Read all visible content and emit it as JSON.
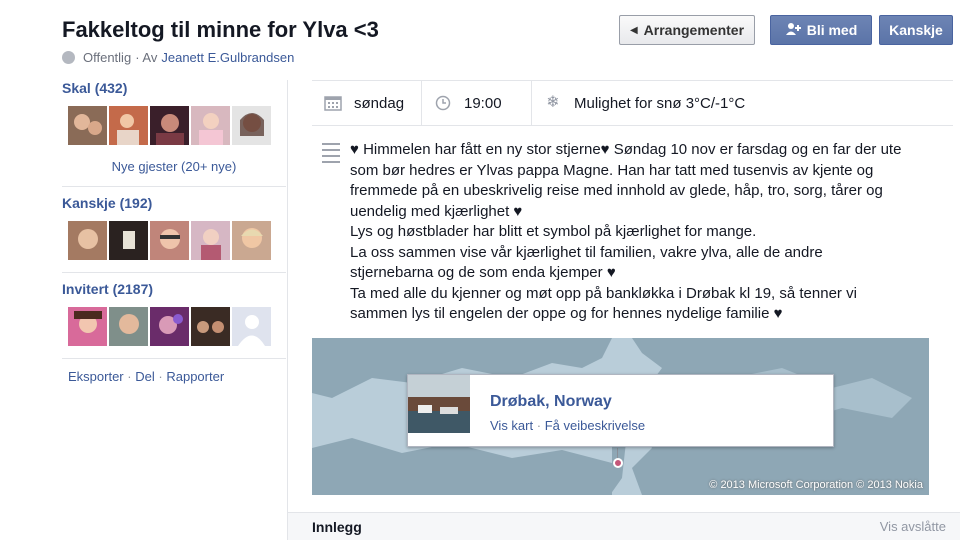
{
  "event": {
    "title": "Fakkeltog til minne for Ylva <3",
    "privacy": "Offentlig",
    "by_prefix": "· Av",
    "author": "Jeanett E.Gulbrandsen"
  },
  "actions": {
    "events_label": "Arrangementer",
    "join_label": "Bli med",
    "maybe_label": "Kanskje"
  },
  "sidebar": {
    "going": {
      "heading": "Skal (432)",
      "link": "Nye gjester (20+ nye)"
    },
    "maybe": {
      "heading": "Kanskje (192)"
    },
    "invited": {
      "heading": "Invitert (2187)"
    },
    "footer": {
      "export": "Eksporter",
      "share": "Del",
      "report": "Rapporter",
      "sep": "·"
    }
  },
  "info": {
    "day": "søndag",
    "time": "19:00",
    "weather": "Mulighet for snø 3°C/-1°C"
  },
  "description": "♥ Himmelen har fått en ny stor stjerne♥ Søndag 10 nov er farsdag og en far der ute\nsom bør hedres er Ylvas pappa Magne. Han har tatt med tusenvis av kjente og\nfremmede på en ubeskrivelig reise med innhold av glede, håp, tro, sorg, tårer og\nuendelig med kjærlighet ♥\nLys og høstblader har blitt et symbol på kjærlighet for mange.\nLa oss sammen vise vår kjærlighet til familien, vakre ylva, alle de andre\nstjernebarna og de som enda kjemper ♥\nTa med alle du kjenner og møt opp på bankløkka i Drøbak kl 19, så tenner vi\nsammen lys til engelen der oppe og for hennes nydelige familie ♥",
  "map": {
    "place": "Drøbak, Norway",
    "view_map": "Vis kart",
    "directions": "Få veibeskrivelse",
    "sep": "·",
    "copyright": "© 2013 Microsoft Corporation © 2013 Nokia"
  },
  "feed": {
    "posts_label": "Innlegg",
    "hidden_label": "Vis avslåtte"
  },
  "colors": {
    "link": "#3b5998",
    "button_blue": "#5b74a8",
    "map_water": "#b9cdd9",
    "map_land": "#8ea7b5"
  }
}
